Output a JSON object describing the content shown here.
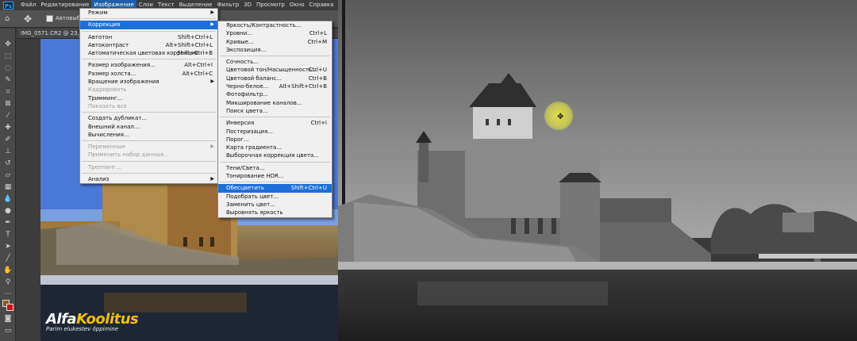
{
  "menubar": {
    "items": [
      "Файл",
      "Редактирование",
      "Изображение",
      "Слои",
      "Текст",
      "Выделение",
      "Фильтр",
      "3D",
      "Просмотр",
      "Окно",
      "Справка"
    ],
    "active_index": 2
  },
  "options": {
    "auto_select_label": "Автовыбор"
  },
  "doc_tab": {
    "title": "IMG_0571.CR2 @ 23,5% ("
  },
  "image_menu": {
    "items": [
      {
        "label": "Режим",
        "shortcut": "",
        "submenu": true,
        "disabled": false,
        "highlight": false
      },
      {
        "sep": true
      },
      {
        "label": "Коррекция",
        "shortcut": "",
        "submenu": true,
        "disabled": false,
        "highlight": true
      },
      {
        "sep": true
      },
      {
        "label": "Автотон",
        "shortcut": "Shift+Ctrl+L",
        "submenu": false,
        "disabled": false,
        "highlight": false
      },
      {
        "label": "Автоконтраст",
        "shortcut": "Alt+Shift+Ctrl+L",
        "submenu": false,
        "disabled": false,
        "highlight": false
      },
      {
        "label": "Автоматическая цветовая коррекция",
        "shortcut": "Shift+Ctrl+B",
        "submenu": false,
        "disabled": false,
        "highlight": false
      },
      {
        "sep": true
      },
      {
        "label": "Размер изображения...",
        "shortcut": "Alt+Ctrl+I",
        "submenu": false,
        "disabled": false,
        "highlight": false
      },
      {
        "label": "Размер холста...",
        "shortcut": "Alt+Ctrl+C",
        "submenu": false,
        "disabled": false,
        "highlight": false
      },
      {
        "label": "Вращение изображения",
        "shortcut": "",
        "submenu": true,
        "disabled": false,
        "highlight": false
      },
      {
        "label": "Кадрировать",
        "shortcut": "",
        "submenu": false,
        "disabled": true,
        "highlight": false
      },
      {
        "label": "Тримминг...",
        "shortcut": "",
        "submenu": false,
        "disabled": false,
        "highlight": false
      },
      {
        "label": "Показать все",
        "shortcut": "",
        "submenu": false,
        "disabled": true,
        "highlight": false
      },
      {
        "sep": true
      },
      {
        "label": "Создать дубликат...",
        "shortcut": "",
        "submenu": false,
        "disabled": false,
        "highlight": false
      },
      {
        "label": "Внешний канал...",
        "shortcut": "",
        "submenu": false,
        "disabled": false,
        "highlight": false
      },
      {
        "label": "Вычисления...",
        "shortcut": "",
        "submenu": false,
        "disabled": false,
        "highlight": false
      },
      {
        "sep": true
      },
      {
        "label": "Переменные",
        "shortcut": "",
        "submenu": true,
        "disabled": true,
        "highlight": false
      },
      {
        "label": "Применить набор данных...",
        "shortcut": "",
        "submenu": false,
        "disabled": true,
        "highlight": false
      },
      {
        "sep": true
      },
      {
        "label": "Треппинг...",
        "shortcut": "",
        "submenu": false,
        "disabled": true,
        "highlight": false
      },
      {
        "sep": true
      },
      {
        "label": "Анализ",
        "shortcut": "",
        "submenu": true,
        "disabled": false,
        "highlight": false
      }
    ]
  },
  "adjust_menu": {
    "items": [
      {
        "label": "Яркость/Контрастность...",
        "shortcut": "",
        "highlight": false
      },
      {
        "label": "Уровни...",
        "shortcut": "Ctrl+L",
        "highlight": false
      },
      {
        "label": "Кривые...",
        "shortcut": "Ctrl+M",
        "highlight": false
      },
      {
        "label": "Экспозиция...",
        "shortcut": "",
        "highlight": false
      },
      {
        "sep": true
      },
      {
        "label": "Сочность...",
        "shortcut": "",
        "highlight": false
      },
      {
        "label": "Цветовой тон/Насыщенность...",
        "shortcut": "Ctrl+U",
        "highlight": false
      },
      {
        "label": "Цветовой баланс...",
        "shortcut": "Ctrl+B",
        "highlight": false
      },
      {
        "label": "Черно-белое...",
        "shortcut": "Alt+Shift+Ctrl+B",
        "highlight": false
      },
      {
        "label": "Фотофильтр...",
        "shortcut": "",
        "highlight": false
      },
      {
        "label": "Микширование каналов...",
        "shortcut": "",
        "highlight": false
      },
      {
        "label": "Поиск цвета...",
        "shortcut": "",
        "highlight": false
      },
      {
        "sep": true
      },
      {
        "label": "Инверсия",
        "shortcut": "Ctrl+I",
        "highlight": false
      },
      {
        "label": "Постеризация...",
        "shortcut": "",
        "highlight": false
      },
      {
        "label": "Порог...",
        "shortcut": "",
        "highlight": false
      },
      {
        "label": "Карта градиента...",
        "shortcut": "",
        "highlight": false
      },
      {
        "label": "Выборочная коррекция цвета...",
        "shortcut": "",
        "highlight": false
      },
      {
        "sep": true
      },
      {
        "label": "Тени/Света...",
        "shortcut": "",
        "highlight": false
      },
      {
        "label": "Тонирование HDR...",
        "shortcut": "",
        "highlight": false
      },
      {
        "sep": true
      },
      {
        "label": "Обесцветить",
        "shortcut": "Shift+Ctrl+U",
        "highlight": true
      },
      {
        "label": "Подобрать цвет...",
        "shortcut": "",
        "highlight": false
      },
      {
        "label": "Заменить цвет...",
        "shortcut": "",
        "highlight": false
      },
      {
        "label": "Выровнять яркость",
        "shortcut": "",
        "highlight": false
      }
    ]
  },
  "watermark": {
    "brand_a": "Alfa",
    "brand_b": "Koolitus",
    "slogan": "Parim elukestev õppimine"
  },
  "colors": {
    "menu_highlight": "#1e70d8",
    "brand_yellow": "#f0c000",
    "ps_blue": "#31a8ff"
  }
}
